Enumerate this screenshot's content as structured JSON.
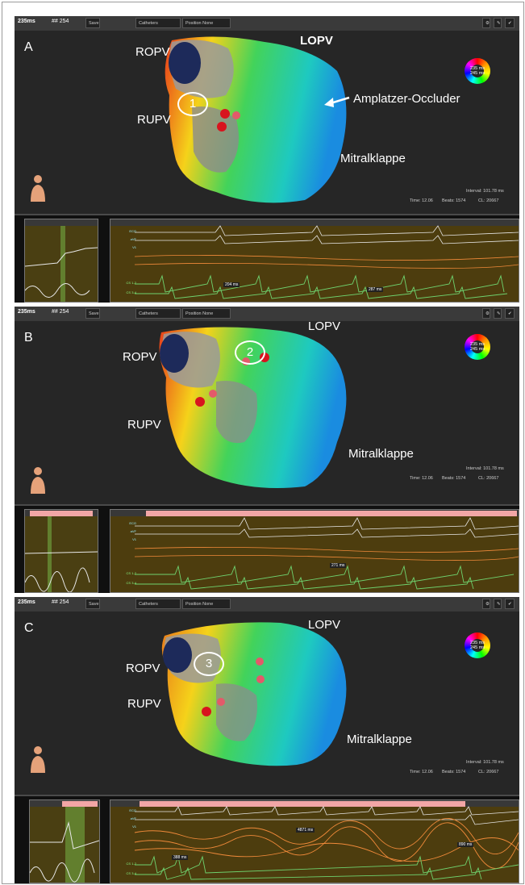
{
  "panels": [
    {
      "letter": "A",
      "toolbar": {
        "cycle_ms": "235ms",
        "count_prefix": "##",
        "count": "254",
        "catheter_menu": "Catheters",
        "position_label": "Position",
        "position_value": "None",
        "save_label": "Save"
      },
      "labels": {
        "ropv": "ROPV",
        "lopv": "LOPV",
        "rupv": "RUPV",
        "mitral": "Mitralklappe",
        "occluder": "Amplatzer-Occluder"
      },
      "circle_number": "1",
      "colorwheel": {
        "line1": "235 ms",
        "line2": "245 ms"
      },
      "stats": {
        "time": "Time: 12.06",
        "beats": "Beats: 1574",
        "interval": "Interval: 101.78 ms",
        "cl": "CL: 20667"
      },
      "track_labels": [
        "ECG",
        "aVF",
        "V1",
        "CS 1-2",
        "CS 3-4"
      ],
      "interval_labels": [
        "204 ms",
        "287 ms"
      ]
    },
    {
      "letter": "B",
      "toolbar": {
        "cycle_ms": "235ms",
        "count_prefix": "##",
        "count": "254",
        "catheter_menu": "Catheters",
        "position_label": "Position",
        "position_value": "None",
        "save_label": "Save"
      },
      "labels": {
        "ropv": "ROPV",
        "lopv": "LOPV",
        "rupv": "RUPV",
        "mitral": "Mitralklappe"
      },
      "circle_number": "2",
      "colorwheel": {
        "line1": "235 ms",
        "line2": "245 ms"
      },
      "stats": {
        "time": "Time: 12.06",
        "beats": "Beats: 1574",
        "interval": "Interval: 101.78 ms",
        "cl": "CL: 20667"
      },
      "track_labels": [
        "ECG",
        "aVF",
        "V1",
        "CS 1-2",
        "CS 3-4"
      ],
      "interval_labels": [
        "271 ms"
      ]
    },
    {
      "letter": "C",
      "toolbar": {
        "cycle_ms": "235ms",
        "count_prefix": "##",
        "count": "254",
        "catheter_menu": "Catheters",
        "position_label": "Position",
        "position_value": "None",
        "save_label": "Save"
      },
      "labels": {
        "ropv": "ROPV",
        "lopv": "LOPV",
        "rupv": "RUPV",
        "mitral": "Mitralklappe"
      },
      "circle_number": "3",
      "colorwheel": {
        "line1": "235 ms",
        "line2": "245 ms"
      },
      "stats": {
        "time": "Time: 12.06",
        "beats": "Beats: 1574",
        "interval": "Interval: 101.78 ms",
        "cl": "CL: 20667"
      },
      "track_labels": [
        "ECG",
        "aVF",
        "V1",
        "CS 1-2",
        "CS 3-4"
      ],
      "interval_labels": [
        "4871 ms",
        "388 ms",
        "890 ms"
      ]
    }
  ],
  "colors": {
    "panel_bg": "#262626",
    "track_bg": "#4d3d0e",
    "ecg_white": "#e8e8e8",
    "cs_green": "#6fd36f",
    "marker": "#f2a6a6"
  }
}
